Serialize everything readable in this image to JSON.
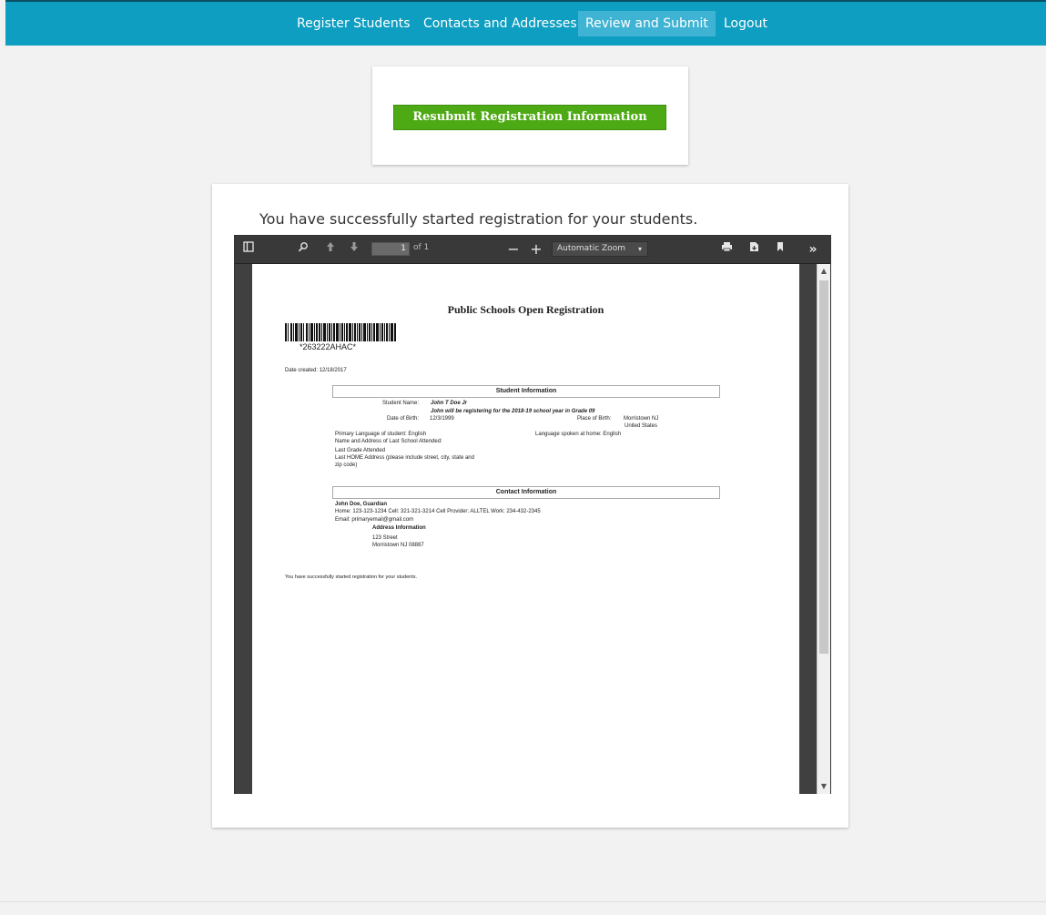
{
  "nav": {
    "items": [
      {
        "label": "Register Students",
        "active": false
      },
      {
        "label": "Contacts and Addresses",
        "active": false
      },
      {
        "label": "Review and Submit",
        "active": true
      },
      {
        "label": "Logout",
        "active": false
      }
    ]
  },
  "resubmit_button": {
    "label": "Resubmit Registration Information"
  },
  "main": {
    "success_message": "You have successfully started registration for your students."
  },
  "viewer": {
    "page_number": "1",
    "page_count_text": "of 1",
    "zoom": "Automatic Zoom",
    "colors": {
      "toolbar": "#393939",
      "background": "#404040"
    }
  },
  "document": {
    "title": "Public Schools Open Registration",
    "barcode_text": "*263222AHAC*",
    "date_created": "Date created: 12/18/2017",
    "student_section": {
      "header": "Student Information",
      "student_name_label": "Student Name:",
      "student_name": "John T Doe Jr",
      "registering_note": "John will be registering for the 2018-19 school year in Grade 09",
      "dob_label": "Date of Birth:",
      "dob": "12/3/1999",
      "pob_label": "Place of Birth:",
      "pob_city": "Morristown NJ",
      "pob_country": "United States",
      "primary_language": "Primary Language of student: English",
      "home_language": "Language spoken at home: English",
      "last_school": "Name and Address of Last School Attended:",
      "last_grade": "Last Grade Attended",
      "last_home_address_1": "Last HOME Address (please include street, city, state and",
      "last_home_address_2": "zip code)"
    },
    "contact_section": {
      "header": "Contact Information",
      "guardian": "John Doe, Guardian",
      "phones": "Home: 123-123-1234  Cell: 321-321-3214  Cell Provider: ALLTEL  Work: 234-432-2345",
      "email": "Email: primaryemail@gmail.com",
      "address_header": "Address Information",
      "address_line1": "123 Street",
      "address_line2": "Morristown NJ  08887"
    },
    "footer_message": "You have successfully started registration for your students."
  },
  "colors": {
    "nav_bar": "#0e9ec1",
    "nav_active": "#3fb3d3",
    "button_green": "#4eaa14",
    "page_bg": "#f2f2f2"
  }
}
